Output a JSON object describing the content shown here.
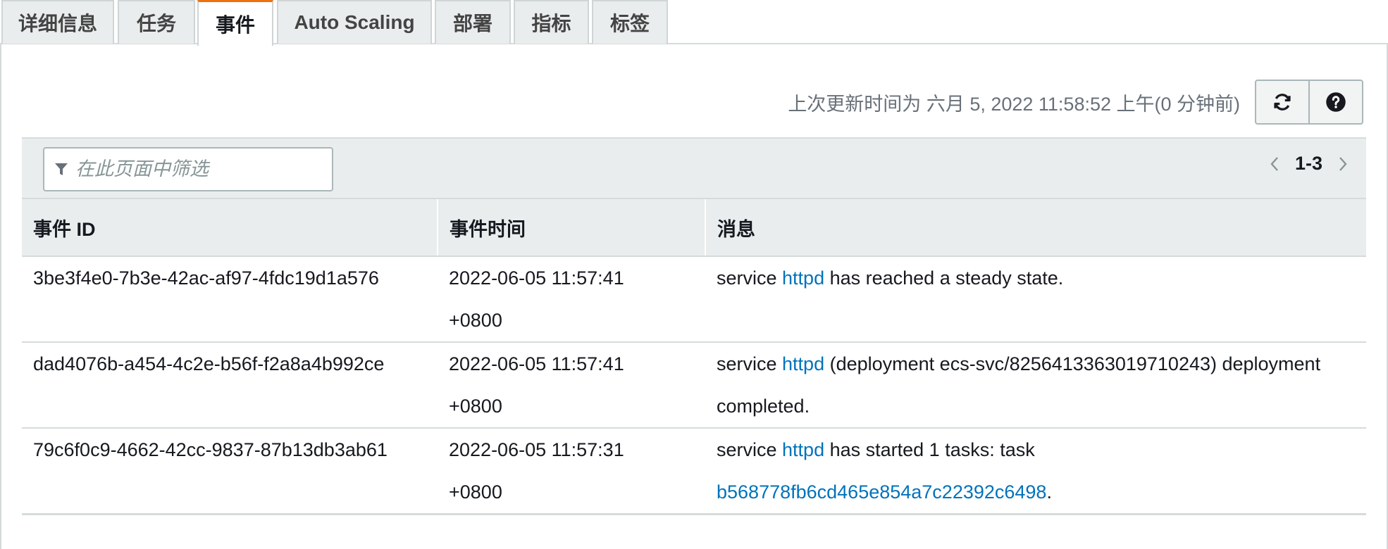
{
  "tabs": [
    {
      "label": "详细信息"
    },
    {
      "label": "任务"
    },
    {
      "label": "事件"
    },
    {
      "label": "Auto Scaling"
    },
    {
      "label": "部署"
    },
    {
      "label": "指标"
    },
    {
      "label": "标签"
    }
  ],
  "active_tab": "事件",
  "status_text": "上次更新时间为 六月 5, 2022 11:58:52 上午(0 分钟前)",
  "icons": {
    "refresh": "refresh-icon",
    "help": "help-icon",
    "filter": "filter-icon"
  },
  "filter": {
    "placeholder": "在此页面中筛选",
    "value": ""
  },
  "pagination": {
    "range": "1-3"
  },
  "table": {
    "columns": [
      "事件 ID",
      "事件时间",
      "消息"
    ],
    "rows": [
      {
        "id": "3be3f4e0-7b3e-42ac-af97-4fdc19d1a576",
        "time_date": "2022-06-05 11:57:41",
        "time_tz": "+0800",
        "msg_pre": "service ",
        "msg_link": "httpd",
        "msg_post": " has reached a steady state."
      },
      {
        "id": "dad4076b-a454-4c2e-b56f-f2a8a4b992ce",
        "time_date": "2022-06-05 11:57:41",
        "time_tz": "+0800",
        "msg_pre": "service ",
        "msg_link": "httpd",
        "msg_post": " (deployment ecs-svc/8256413363019710243) deployment completed."
      },
      {
        "id": "79c6f0c9-4662-42cc-9837-87b13db3ab61",
        "time_date": "2022-06-05 11:57:31",
        "time_tz": "+0800",
        "msg_pre": "service ",
        "msg_link": "httpd",
        "msg_mid": " has started 1 tasks: task ",
        "msg_link2": "b568778fb6cd465e854a7c22392c6498",
        "msg_post": "."
      }
    ]
  },
  "colors": {
    "accent": "#ec7211",
    "link": "#0073bb",
    "header_bg": "#eaeded",
    "border": "#d5dbdb"
  }
}
